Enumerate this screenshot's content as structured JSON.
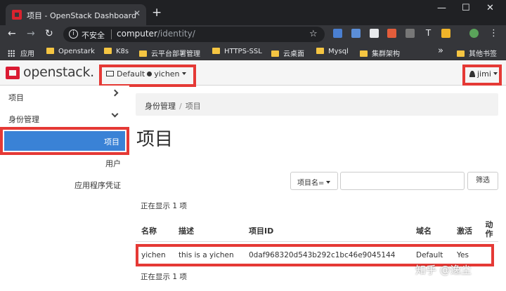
{
  "browser": {
    "tab_title": "项目 - OpenStack Dashboard",
    "tab_close": "✕",
    "new_tab": "+",
    "win_minimize": "—",
    "win_maximize": "☐",
    "win_close": "✕",
    "security_label": "不安全",
    "url_host": "computer",
    "url_path": "/identity/",
    "star": "☆"
  },
  "bookmarks": [
    {
      "label": "应用",
      "kind": "apps"
    },
    {
      "label": "Openstark",
      "kind": "folder"
    },
    {
      "label": "K8s",
      "kind": "folder"
    },
    {
      "label": "云平台部署管理",
      "kind": "folder"
    },
    {
      "label": "HTTPS-SSL",
      "kind": "folder"
    },
    {
      "label": "云桌面",
      "kind": "folder"
    },
    {
      "label": "Mysql",
      "kind": "folder"
    },
    {
      "label": "集群架构",
      "kind": "folder"
    },
    {
      "label": "»",
      "kind": "more"
    },
    {
      "label": "其他书签",
      "kind": "folder"
    }
  ],
  "header": {
    "logo_text": "openstack.",
    "domain": "Default",
    "project": "yichen",
    "user": "jimi"
  },
  "sidebar": {
    "items": [
      {
        "label": "项目"
      },
      {
        "label": "身份管理"
      }
    ],
    "active": "项目",
    "sub_items": [
      {
        "label": "用户"
      },
      {
        "label": "应用程序凭证"
      }
    ]
  },
  "main": {
    "breadcrumb": [
      "身份管理",
      "项目"
    ],
    "title": "项目",
    "filter_dropdown": "项目名=",
    "filter_button": "筛选",
    "showing_top": "正在显示 1 项",
    "showing_bottom": "正在显示 1 项",
    "columns": [
      "名称",
      "描述",
      "项目ID",
      "域名",
      "激活",
      "动作"
    ],
    "rows": [
      {
        "name": "yichen",
        "description": "this is a yichen",
        "id": "0daf968320d543b292c1bc46e9045144",
        "domain": "Default",
        "enabled": "Yes"
      }
    ]
  },
  "watermark": "知乎 @逸尘",
  "colors": {
    "highlight": "#e53935",
    "active_nav": "#3a82d6",
    "openstack_red": "#da1a32"
  }
}
